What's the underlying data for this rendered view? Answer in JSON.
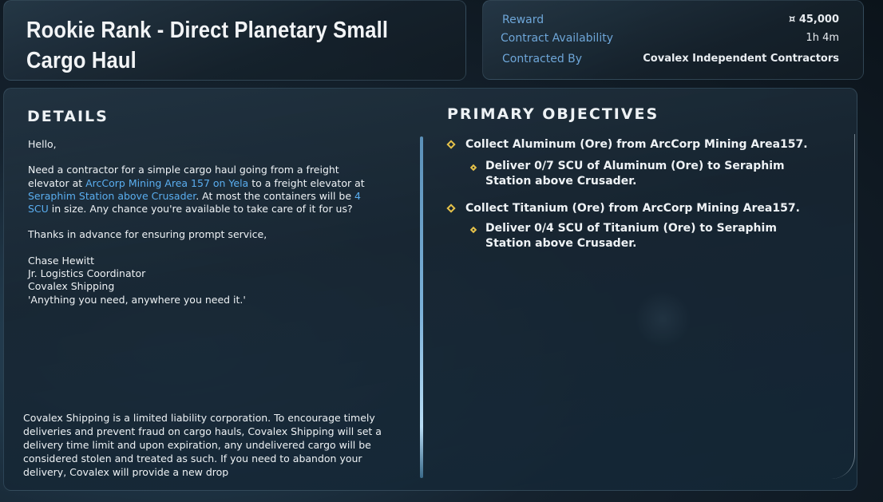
{
  "contract": {
    "title": "Rookie Rank - Direct Planetary Small Cargo Haul"
  },
  "info": {
    "reward_label": "Reward",
    "reward_value": "¤ 45,000",
    "availability_label": "Contract Availability",
    "availability_value": "1h 4m",
    "contracted_by_label": "Contracted By",
    "contracted_by_value": "Covalex Independent Contractors"
  },
  "details": {
    "heading": "DETAILS",
    "greeting": "Hello,",
    "body_1": "Need a contractor for a simple cargo haul going from a freight elevator at ",
    "pickup": "ArcCorp Mining Area 157 on Yela",
    "body_2": " to a freight elevator at ",
    "dropoff": "Seraphim Station above Crusader",
    "body_3": ". At most the containers will be ",
    "size": "4 SCU",
    "body_4": " in size. Any chance you're available to take care of it for us?",
    "thanks": "Thanks in advance for ensuring prompt service,",
    "sig_name": "Chase Hewitt",
    "sig_title": "Jr. Logistics Coordinator",
    "sig_company": "Covalex Shipping",
    "sig_motto": "'Anything you need, anywhere you need it.'",
    "disclaimer": "Covalex Shipping is a limited liability corporation. To encourage timely deliveries and prevent fraud on cargo hauls, Covalex Shipping will set a delivery time limit and upon expiration, any undelivered cargo will be considered stolen and treated as such. If you need to abandon your delivery, Covalex will provide a new drop"
  },
  "objectives": {
    "heading": "PRIMARY OBJECTIVES",
    "items": [
      {
        "main": "Collect Aluminum (Ore) from ArcCorp Mining Area157.",
        "sub": "Deliver 0/7 SCU of Aluminum (Ore) to Seraphim Station above Crusader."
      },
      {
        "main": "Collect Titanium (Ore) from ArcCorp Mining Area157.",
        "sub": "Deliver 0/4 SCU of Titanium (Ore) to Seraphim Station above Crusader."
      }
    ]
  },
  "colors": {
    "accent_link": "#5aaef0",
    "label_blue": "#6ea6d8",
    "objective_marker": "#e6c24a"
  }
}
